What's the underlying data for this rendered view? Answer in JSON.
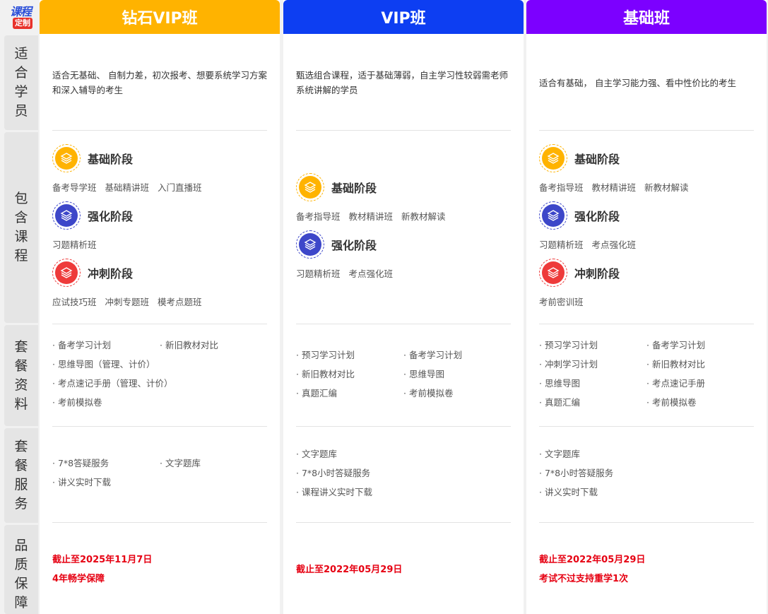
{
  "logo": {
    "line1": "课程",
    "line2": "定制"
  },
  "row_labels": [
    "适合学员",
    "包含课程",
    "套餐资料",
    "套餐服务",
    "品质保障"
  ],
  "colors": {
    "diamond": "#ffb300",
    "vip": "#0d3ef2",
    "basic": "#7c00ff",
    "stage_basic": "#ffb300",
    "stage_strengthen": "#3d47c9",
    "stage_sprint": "#ee3a3a",
    "guarantee": "#e60012"
  },
  "columns": [
    {
      "title": "钻石VIP班",
      "suitable": "适合无基础、 自制力差，初次报考、想要系统学习方案和深入辅导的考生",
      "stages": [
        {
          "icon": "layers-icon",
          "title": "基础阶段",
          "courses": [
            "备考导学班",
            "基础精讲班",
            "入门直播班"
          ]
        },
        {
          "icon": "layers-icon",
          "title": "强化阶段",
          "courses": [
            "习题精析班"
          ]
        },
        {
          "icon": "layers-icon",
          "title": "冲刺阶段",
          "courses": [
            "应试技巧班",
            "冲刺专题班",
            "模考点题班"
          ]
        }
      ],
      "materials": [
        "· 备考学习计划",
        "· 新旧教材对比",
        "· 思维导图（管理、计价）",
        "· 考点速记手册（管理、计价）",
        "· 考前模拟卷"
      ],
      "services": [
        "· 7*8答疑服务",
        "· 文字题库",
        "· 讲义实时下载"
      ],
      "guarantee": [
        "截止至2025年11月7日",
        "4年畅学保障"
      ]
    },
    {
      "title": "VIP班",
      "suitable": "甄选组合课程，适于基础薄弱，自主学习性较弱需老师系统讲解的学员",
      "stages": [
        {
          "icon": "layers-icon",
          "title": "基础阶段",
          "courses": [
            "备考指导班",
            "教材精讲班",
            "新教材解读"
          ]
        },
        {
          "icon": "layers-icon",
          "title": "强化阶段",
          "courses": [
            "习题精析班",
            "考点强化班"
          ]
        }
      ],
      "materials": [
        "· 预习学习计划",
        "· 备考学习计划",
        "· 新旧教材对比",
        "· 思维导图",
        "· 真题汇编",
        "· 考前模拟卷"
      ],
      "services": [
        "· 文字题库",
        "· 7*8小时答疑服务",
        "· 课程讲义实时下载"
      ],
      "guarantee": [
        "截止至2022年05月29日"
      ]
    },
    {
      "title": "基础班",
      "suitable": "适合有基础， 自主学习能力强、看中性价比的考生",
      "stages": [
        {
          "icon": "layers-icon",
          "title": "基础阶段",
          "courses": [
            "备考指导班",
            "教材精讲班",
            "新教材解读"
          ]
        },
        {
          "icon": "layers-icon",
          "title": "强化阶段",
          "courses": [
            "习题精析班",
            "考点强化班"
          ]
        },
        {
          "icon": "layers-icon",
          "title": "冲刺阶段",
          "courses": [
            "考前密训班"
          ]
        }
      ],
      "materials": [
        "· 预习学习计划",
        "· 备考学习计划",
        "· 冲刺学习计划",
        "· 新旧教材对比",
        "· 思维导图",
        "· 考点速记手册",
        "· 真题汇编",
        "· 考前模拟卷"
      ],
      "services": [
        "· 文字题库",
        "· 7*8小时答疑服务",
        "· 讲义实时下载"
      ],
      "guarantee": [
        "截止至2022年05月29日",
        "考试不过支持重学1次"
      ]
    }
  ]
}
